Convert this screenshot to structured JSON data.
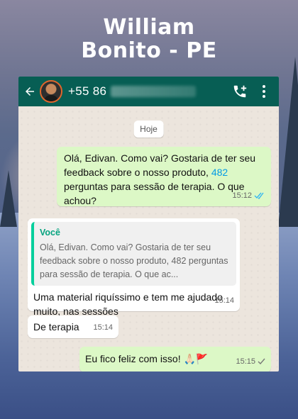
{
  "title_line1": "William",
  "title_line2": "Bonito - PE",
  "header": {
    "phone_prefix": "+55 86",
    "back_icon": "arrow-left-icon",
    "call_icon": "add-call-icon",
    "menu_icon": "kebab-menu-icon"
  },
  "date_label": "Hoje",
  "messages": [
    {
      "text_before_link": "Olá, Edivan. Como vai? Gostaria de ter seu feedback sobre o nosso produto, ",
      "link": "482",
      "text_after_link": " perguntas para sessão de terapia. O que achou?",
      "time": "15:12",
      "status": "read"
    },
    {
      "quote_author": "Você",
      "quote_text": "Olá, Edivan. Como vai? Gostaria de ter seu feedback sobre o nosso produto, 482 perguntas para sessão de terapia. O que ac...",
      "text": "Uma material riquíssimo e tem me ajudado muito, nas sessões",
      "time": "15:14"
    },
    {
      "text": "De terapia",
      "time": "15:14"
    },
    {
      "text": "Eu fico feliz com isso! 🙏🏻🚩",
      "time": "15:15",
      "status": "sent"
    }
  ],
  "colors": {
    "topbar": "#075e54",
    "outgoing": "#dcf8c6",
    "incoming": "#ffffff",
    "read_tick": "#34b7f1",
    "quote_bar": "#06cf9c"
  }
}
